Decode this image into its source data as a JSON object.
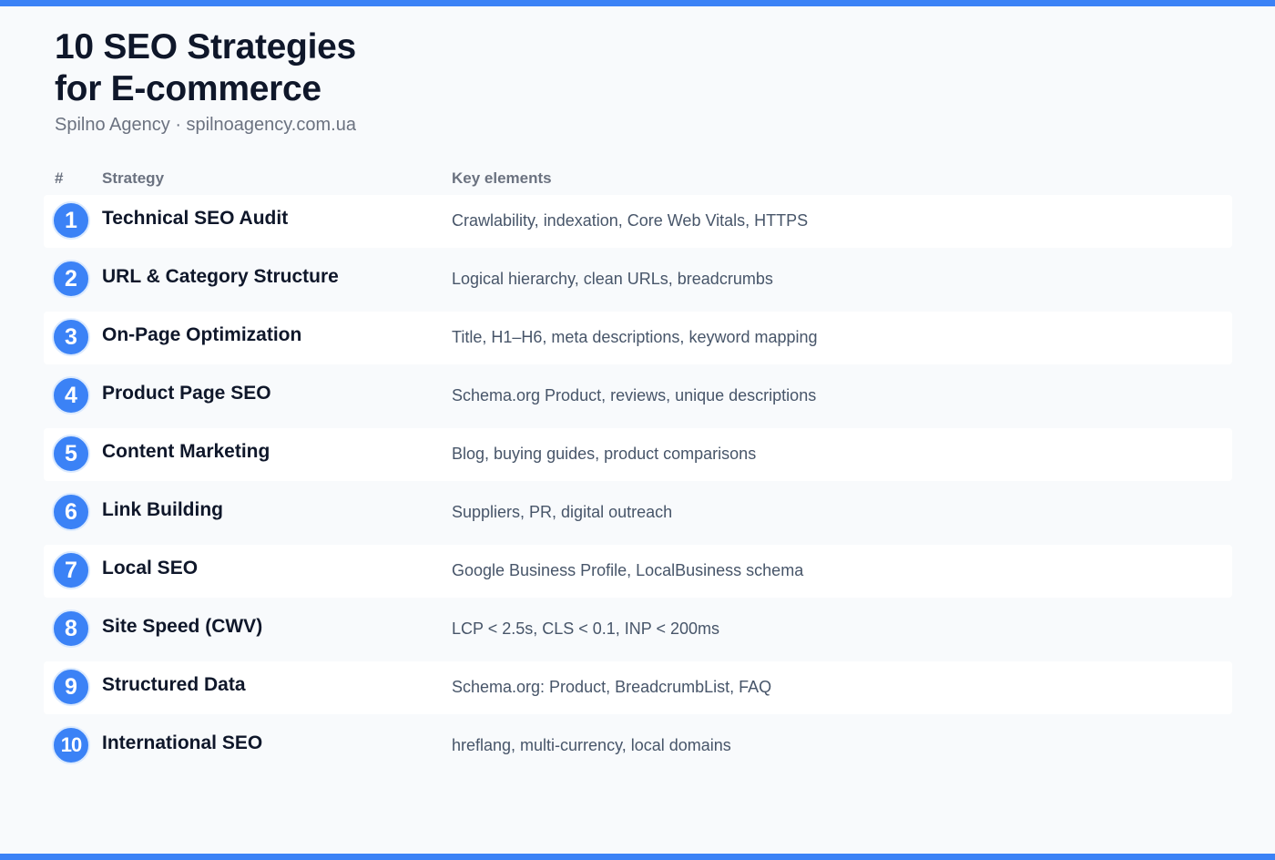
{
  "header": {
    "title_line1": "10 SEO Strategies",
    "title_line2": "for E-commerce",
    "subtitle": "Spilno Agency · spilnoagency.com.ua"
  },
  "table": {
    "columns": [
      "#",
      "Strategy",
      "Key elements"
    ],
    "rows": [
      {
        "num": "1",
        "strategy": "Technical SEO Audit",
        "elements": "Crawlability, indexation, Core Web Vitals, HTTPS"
      },
      {
        "num": "2",
        "strategy": "URL & Category Structure",
        "elements": "Logical hierarchy, clean URLs, breadcrumbs"
      },
      {
        "num": "3",
        "strategy": "On-Page Optimization",
        "elements": "Title, H1–H6, meta descriptions, keyword mapping"
      },
      {
        "num": "4",
        "strategy": "Product Page SEO",
        "elements": "Schema.org Product, reviews, unique descriptions"
      },
      {
        "num": "5",
        "strategy": "Content Marketing",
        "elements": "Blog, buying guides, product comparisons"
      },
      {
        "num": "6",
        "strategy": "Link Building",
        "elements": "Suppliers, PR, digital outreach"
      },
      {
        "num": "7",
        "strategy": "Local SEO",
        "elements": "Google Business Profile, LocalBusiness schema"
      },
      {
        "num": "8",
        "strategy": "Site Speed (CWV)",
        "elements": "LCP < 2.5s, CLS < 0.1, INP < 200ms"
      },
      {
        "num": "9",
        "strategy": "Structured Data",
        "elements": "Schema.org: Product, BreadcrumbList, FAQ"
      },
      {
        "num": "10",
        "strategy": "International SEO",
        "elements": "hreflang, multi-currency, local domains"
      }
    ]
  },
  "colors": {
    "accent": "#3b82f6",
    "title": "#0f172a",
    "muted": "#6b7280",
    "row_alt": "#ffffff",
    "background": "#f8fafc"
  }
}
